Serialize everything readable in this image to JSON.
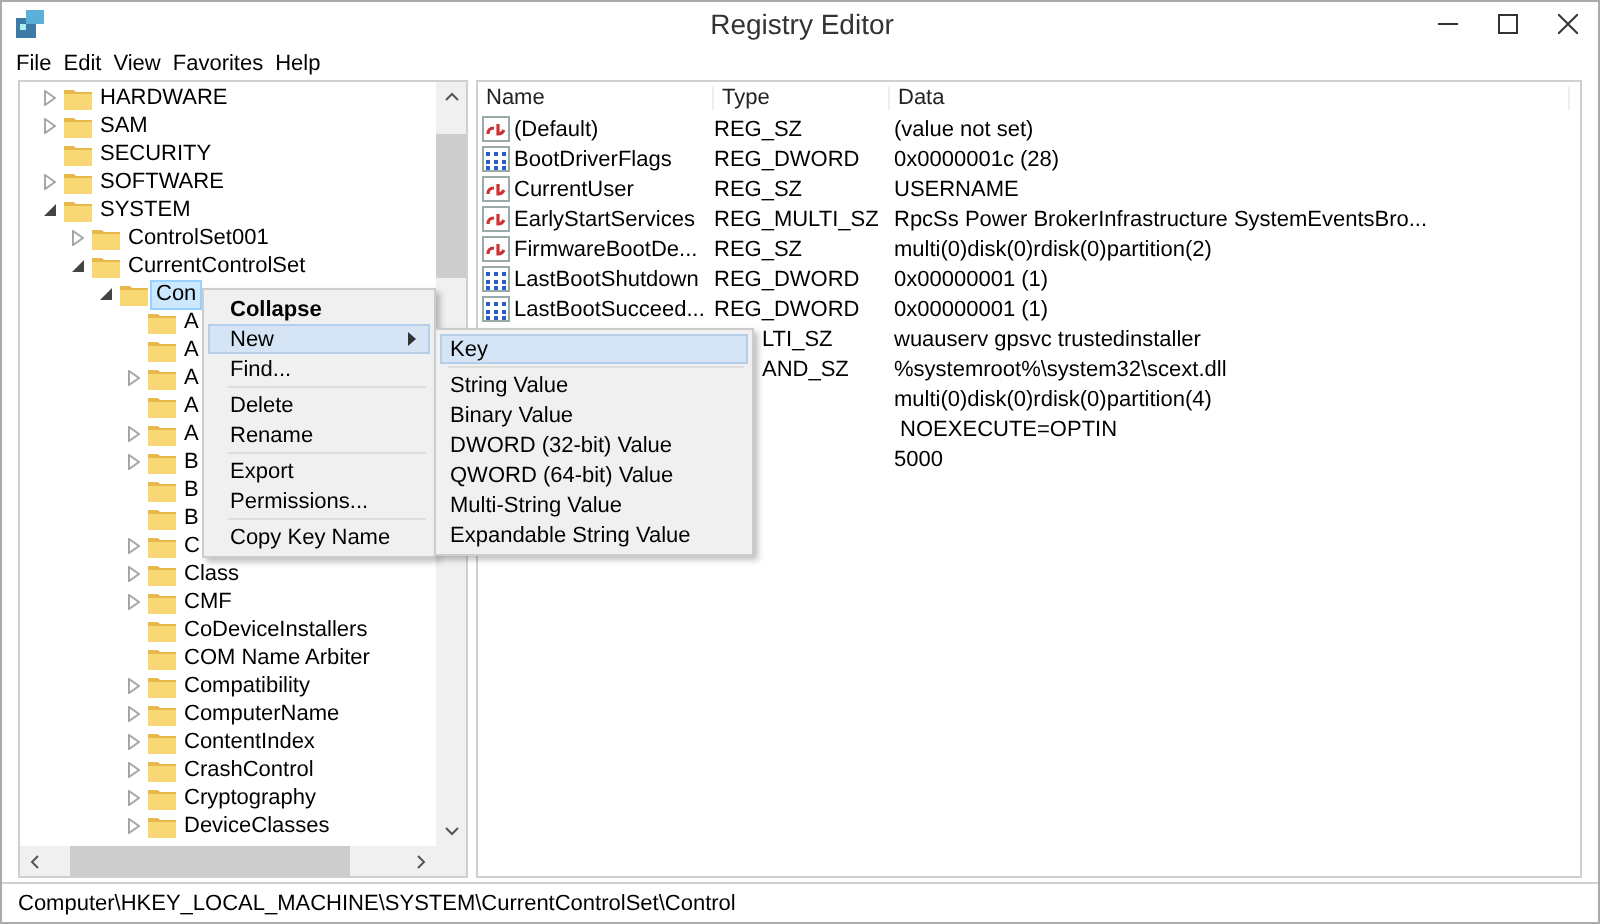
{
  "window": {
    "title": "Registry Editor"
  },
  "menu_bar": [
    "File",
    "Edit",
    "View",
    "Favorites",
    "Help"
  ],
  "tree": [
    {
      "label": "HARDWARE",
      "kind": "branch",
      "expanded": false,
      "selected": false
    },
    {
      "label": "SAM",
      "kind": "branch",
      "expanded": false,
      "selected": false
    },
    {
      "label": "SECURITY",
      "kind": "leaf",
      "selected": false
    },
    {
      "label": "SOFTWARE",
      "kind": "branch",
      "expanded": false,
      "selected": false
    },
    {
      "label": "SYSTEM",
      "kind": "branch",
      "expanded": true,
      "selected": false,
      "children": [
        {
          "label": "ControlSet001",
          "kind": "branch",
          "expanded": false,
          "selected": false
        },
        {
          "label": "CurrentControlSet",
          "kind": "branch",
          "expanded": true,
          "selected": false,
          "children": [
            {
              "label": "Con",
              "kind": "branch",
              "expanded": true,
              "selected": true,
              "children": [
                {
                  "label": "A",
                  "kind": "leaf",
                  "selected": false
                },
                {
                  "label": "A",
                  "kind": "leaf",
                  "selected": false
                },
                {
                  "label": "A",
                  "kind": "branch",
                  "expanded": false,
                  "selected": false
                },
                {
                  "label": "A",
                  "kind": "leaf",
                  "selected": false
                },
                {
                  "label": "A",
                  "kind": "branch",
                  "expanded": false,
                  "selected": false
                },
                {
                  "label": "B",
                  "kind": "branch",
                  "expanded": false,
                  "selected": false
                },
                {
                  "label": "B",
                  "kind": "leaf",
                  "selected": false
                },
                {
                  "label": "B",
                  "kind": "leaf",
                  "selected": false
                },
                {
                  "label": "C",
                  "kind": "branch",
                  "expanded": false,
                  "selected": false
                },
                {
                  "label": "Class",
                  "kind": "branch",
                  "expanded": false,
                  "selected": false
                },
                {
                  "label": "CMF",
                  "kind": "branch",
                  "expanded": false,
                  "selected": false
                },
                {
                  "label": "CoDeviceInstallers",
                  "kind": "leaf",
                  "selected": false
                },
                {
                  "label": "COM Name Arbiter",
                  "kind": "leaf",
                  "selected": false
                },
                {
                  "label": "Compatibility",
                  "kind": "branch",
                  "expanded": false,
                  "selected": false
                },
                {
                  "label": "ComputerName",
                  "kind": "branch",
                  "expanded": false,
                  "selected": false
                },
                {
                  "label": "ContentIndex",
                  "kind": "branch",
                  "expanded": false,
                  "selected": false
                },
                {
                  "label": "CrashControl",
                  "kind": "branch",
                  "expanded": false,
                  "selected": false
                },
                {
                  "label": "Cryptography",
                  "kind": "branch",
                  "expanded": false,
                  "selected": false
                },
                {
                  "label": "DeviceClasses",
                  "kind": "branch",
                  "expanded": false,
                  "selected": false
                }
              ]
            }
          ]
        }
      ]
    }
  ],
  "values": {
    "columns": [
      "Name",
      "Type",
      "Data"
    ],
    "rows": [
      {
        "kind": "string",
        "name": "(Default)",
        "type": "REG_SZ",
        "data": "(value not set)"
      },
      {
        "kind": "binary",
        "name": "BootDriverFlags",
        "type": "REG_DWORD",
        "data": "0x0000001c (28)"
      },
      {
        "kind": "string",
        "name": "CurrentUser",
        "type": "REG_SZ",
        "data": "USERNAME"
      },
      {
        "kind": "string",
        "name": "EarlyStartServices",
        "type": "REG_MULTI_SZ",
        "data": "RpcSs Power BrokerInfrastructure SystemEventsBro..."
      },
      {
        "kind": "string",
        "name": "FirmwareBootDe...",
        "type": "REG_SZ",
        "data": "multi(0)disk(0)rdisk(0)partition(2)"
      },
      {
        "kind": "binary",
        "name": "LastBootShutdown",
        "type": "REG_DWORD",
        "data": "0x00000001 (1)"
      },
      {
        "kind": "binary",
        "name": "LastBootSucceed...",
        "type": "REG_DWORD",
        "data": "0x00000001 (1)"
      },
      {
        "kind": "covered",
        "type": "LTI_SZ",
        "data": "wuauserv gpsvc trustedinstaller"
      },
      {
        "kind": "covered",
        "type": "AND_SZ",
        "data": "%systemroot%\\system32\\scext.dll"
      },
      {
        "kind": "covered",
        "data": "multi(0)disk(0)rdisk(0)partition(4)"
      },
      {
        "kind": "covered",
        "data": " NOEXECUTE=OPTIN"
      },
      {
        "kind": "covered",
        "data": "5000"
      }
    ]
  },
  "context_menu": {
    "groups": [
      [
        {
          "label": "Collapse",
          "default": true,
          "selected": false,
          "submenu": false
        },
        {
          "label": "New",
          "default": false,
          "selected": true,
          "submenu": true
        },
        {
          "label": "Find...",
          "default": false,
          "selected": false,
          "submenu": false
        }
      ],
      [
        {
          "label": "Delete",
          "default": false,
          "selected": false,
          "submenu": false
        },
        {
          "label": "Rename",
          "default": false,
          "selected": false,
          "submenu": false
        }
      ],
      [
        {
          "label": "Export",
          "default": false,
          "selected": false,
          "submenu": false
        },
        {
          "label": "Permissions...",
          "default": false,
          "selected": false,
          "submenu": false
        }
      ],
      [
        {
          "label": "Copy Key Name",
          "default": false,
          "selected": false,
          "submenu": false
        }
      ]
    ]
  },
  "submenu": {
    "groups": [
      [
        {
          "label": "Key",
          "selected": true
        }
      ],
      [
        {
          "label": "String Value",
          "selected": false
        },
        {
          "label": "Binary Value",
          "selected": false
        },
        {
          "label": "DWORD (32-bit) Value",
          "selected": false
        },
        {
          "label": "QWORD (64-bit) Value",
          "selected": false
        },
        {
          "label": "Multi-String Value",
          "selected": false
        },
        {
          "label": "Expandable String Value",
          "selected": false
        }
      ]
    ]
  },
  "status_bar": "Computer\\HKEY_LOCAL_MACHINE\\SYSTEM\\CurrentControlSet\\Control"
}
